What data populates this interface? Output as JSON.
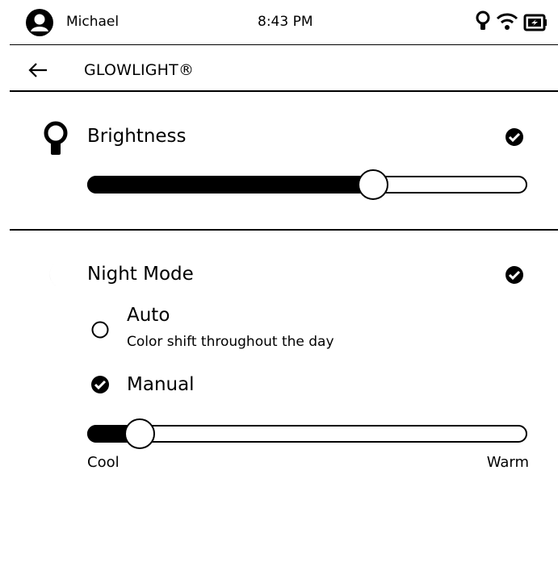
{
  "status_bar": {
    "user_name": "Michael",
    "time": "8:43 PM",
    "icons": [
      "avatar-icon",
      "lightbulb-icon",
      "wifi-icon",
      "battery-charging-icon"
    ]
  },
  "header": {
    "title": "GLOWLIGHT®",
    "back_icon": "back-arrow-icon"
  },
  "brightness": {
    "label": "Brightness",
    "icon": "lightbulb-icon",
    "enabled": true,
    "level": 0.65
  },
  "night_mode": {
    "label": "Night Mode",
    "icon": "moon-icon",
    "enabled": true,
    "options": [
      {
        "label": "Auto",
        "description": "Color shift throughout the day",
        "selected": false
      },
      {
        "label": "Manual",
        "selected": true
      }
    ],
    "warmth": {
      "level": 0.12,
      "min_label": "Cool",
      "max_label": "Warm"
    }
  },
  "colors": {
    "ink": "#000000",
    "paper": "#ffffff"
  }
}
